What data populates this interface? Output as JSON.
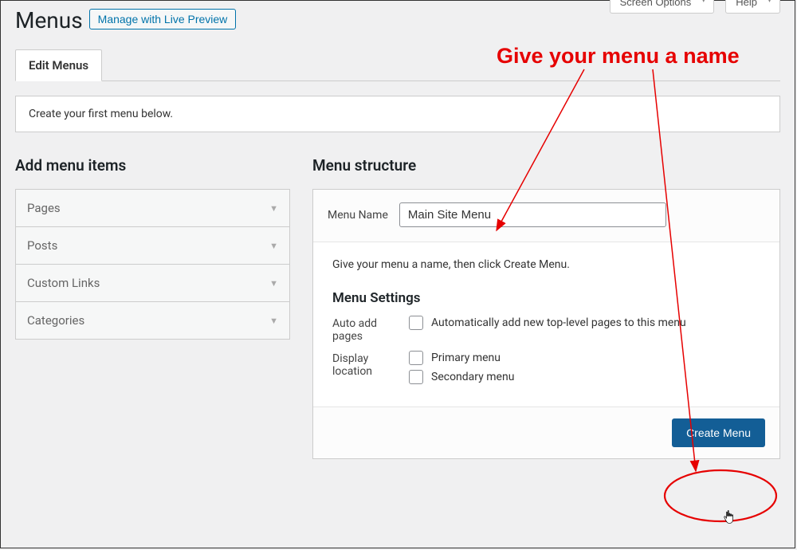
{
  "header": {
    "title": "Menus",
    "live_preview_btn": "Manage with Live Preview",
    "screen_options": "Screen Options",
    "help": "Help"
  },
  "tabs": {
    "edit_menus": "Edit Menus"
  },
  "notice": "Create your first menu below.",
  "left": {
    "heading": "Add menu items",
    "items": [
      "Pages",
      "Posts",
      "Custom Links",
      "Categories"
    ]
  },
  "right": {
    "heading": "Menu structure",
    "menu_name_label": "Menu Name",
    "menu_name_value": "Main Site Menu",
    "instruction": "Give your menu a name, then click Create Menu.",
    "settings_heading": "Menu Settings",
    "auto_add_label": "Auto add pages",
    "auto_add_option": "Automatically add new top-level pages to this menu",
    "display_loc_label": "Display location",
    "display_loc_options": [
      "Primary menu",
      "Secondary menu"
    ],
    "create_btn": "Create Menu"
  },
  "annotation": {
    "text": "Give your menu a name"
  }
}
